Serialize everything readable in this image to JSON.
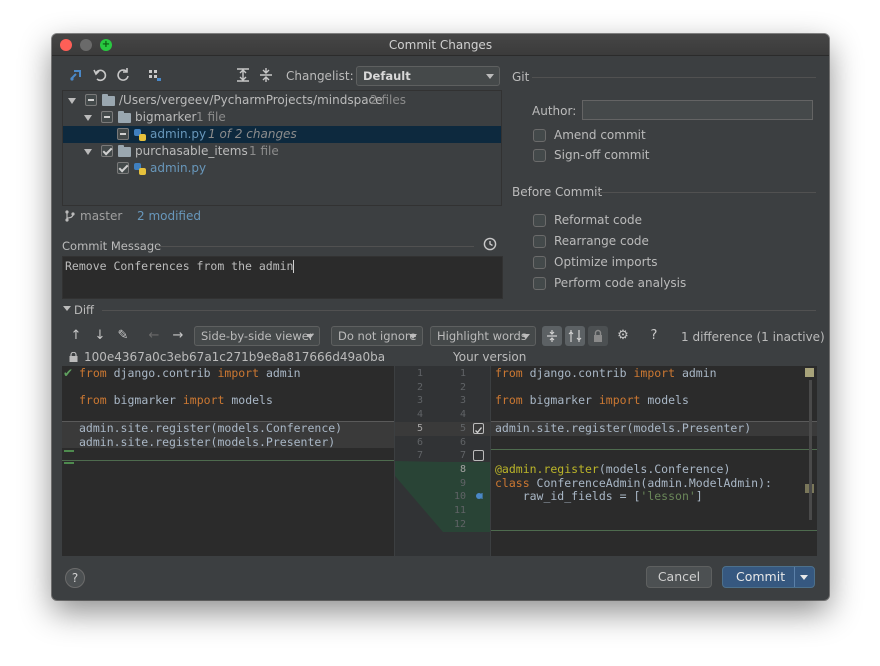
{
  "window": {
    "title": "Commit Changes"
  },
  "toolbar": {
    "changelist_label": "Changelist:",
    "changelist_value": "Default"
  },
  "git": {
    "section_label": "Git",
    "author_label": "Author:",
    "author_value": "",
    "amend_commit": "Amend commit",
    "signoff_commit": "Sign-off commit"
  },
  "before_commit": {
    "section_label": "Before Commit",
    "options": [
      "Reformat code",
      "Rearrange code",
      "Optimize imports",
      "Perform code analysis"
    ]
  },
  "tree": {
    "root_path": "/Users/vergeev/PycharmProjects/mindspace",
    "root_count": "2 files",
    "folder1": "bigmarker",
    "folder1_count": "1 file",
    "file1": "admin.py",
    "file1_note": "1 of 2 changes",
    "folder2": "purchasable_items",
    "folder2_count": "1 file",
    "file2": "admin.py"
  },
  "status": {
    "branch": "master",
    "modified": "2 modified"
  },
  "commit_message": {
    "label": "Commit Message",
    "text": "Remove Conferences from the admin"
  },
  "diff": {
    "label": "Diff",
    "viewer": "Side-by-side viewer",
    "ignore": "Do not ignore",
    "highlight": "Highlight words",
    "summary": "1 difference (1 inactive)",
    "left_revision": "100e4367a0c3eb67a1c271b9e8a817666d49a0ba",
    "right_label": "Your version",
    "left_gutter": [
      "1",
      "2",
      "3",
      "4",
      "5",
      "6",
      "7"
    ],
    "right_gutter": [
      "1",
      "2",
      "3",
      "4",
      "5",
      "6",
      "7",
      "8",
      "9",
      "10",
      "11",
      "12"
    ],
    "left_lines": [
      {
        "kw1": "from",
        "t1": " django.contrib ",
        "kw2": "import",
        "t2": " admin"
      },
      {
        "kw1": "",
        "t1": "",
        "kw2": "",
        "t2": ""
      },
      {
        "kw1": "from",
        "t1": " bigmarker ",
        "kw2": "import",
        "t2": " models"
      },
      {
        "kw1": "",
        "t1": "",
        "kw2": "",
        "t2": ""
      },
      {
        "kw1": "",
        "t1": "admin.site.register(models.Conference)",
        "kw2": "",
        "t2": ""
      },
      {
        "kw1": "",
        "t1": "admin.site.register(models.Presenter)",
        "kw2": "",
        "t2": ""
      }
    ],
    "right_lines": {
      "l1": {
        "kw1": "from",
        "t1": " django.contrib ",
        "kw2": "import",
        "t2": " admin"
      },
      "l3": {
        "kw1": "from",
        "t1": " bigmarker ",
        "kw2": "import",
        "t2": " models"
      },
      "l5": "admin.site.register(models.Presenter)",
      "l8_deco": "@admin.register",
      "l8_rest": "(models.Conference)",
      "l9_kw": "class",
      "l9_rest": " ConferenceAdmin(admin.ModelAdmin):",
      "l10_pre": "    raw_id_fields = [",
      "l10_str": "'lesson'",
      "l10_post": "]"
    }
  },
  "footer": {
    "help": "?",
    "cancel": "Cancel",
    "commit": "Commit"
  },
  "colors": {
    "accent": "#365880",
    "selection": "#0d293e",
    "editor_bg": "#2b2b2b"
  }
}
